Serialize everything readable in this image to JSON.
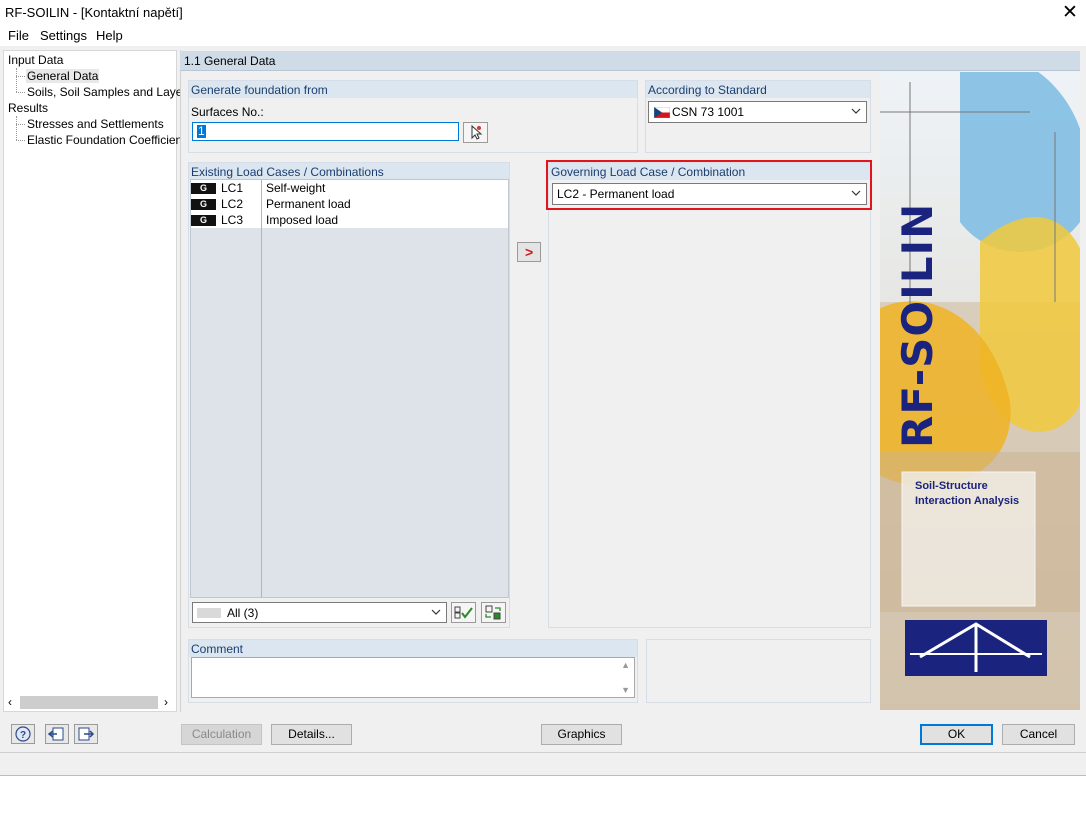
{
  "window": {
    "title": "RF-SOILIN - [Kontaktní napětí]",
    "close_glyph": "✕"
  },
  "menu": {
    "items": [
      "File",
      "Settings",
      "Help"
    ]
  },
  "nav": {
    "input_data": "Input Data",
    "general_data": "General Data",
    "soils": "Soils, Soil Samples and Layers",
    "results": "Results",
    "stresses": "Stresses and Settlements",
    "elastic": "Elastic Foundation Coefficients"
  },
  "section": {
    "title": "1.1 General Data"
  },
  "generate": {
    "header": "Generate foundation from",
    "surfaces_label": "Surfaces No.:",
    "surfaces_value": "1"
  },
  "standard": {
    "header": "According to Standard",
    "value": "CSN 73 1001",
    "flag": "czech-flag-icon"
  },
  "existing": {
    "header": "Existing Load Cases / Combinations",
    "rows": [
      {
        "badge": "G",
        "id": "LC1",
        "desc": "Self-weight"
      },
      {
        "badge": "G",
        "id": "LC2",
        "desc": "Permanent load"
      },
      {
        "badge": "G",
        "id": "LC3",
        "desc": "Imposed load"
      }
    ],
    "filter_value": "All (3)"
  },
  "transfer": {
    "arrow": ">"
  },
  "governing": {
    "header": "Governing Load Case / Combination",
    "value": "LC2 - Permanent load",
    "highlight_color": "#e0161b"
  },
  "comment": {
    "header": "Comment"
  },
  "logo": {
    "product": "RF-SOILIN",
    "tagline_1": "Soil-Structure",
    "tagline_2": "Interaction Analysis",
    "brand_color": "#1a237e"
  },
  "footer": {
    "calculation": "Calculation",
    "details": "Details...",
    "graphics": "Graphics",
    "ok": "OK",
    "cancel": "Cancel"
  },
  "chevron": "⌵"
}
